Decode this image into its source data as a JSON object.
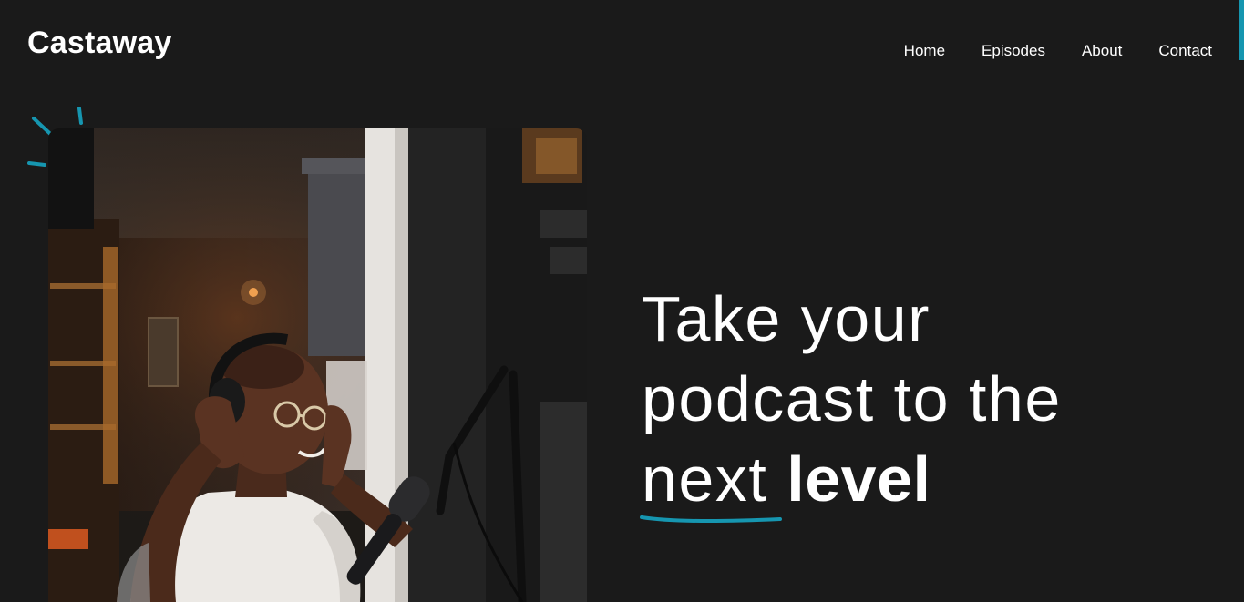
{
  "site": {
    "brand": "Castaway"
  },
  "nav": {
    "items": [
      {
        "label": "Home"
      },
      {
        "label": "Episodes"
      },
      {
        "label": "About"
      },
      {
        "label": "Contact"
      }
    ]
  },
  "hero": {
    "headline_line1": "Take your",
    "headline_line2": "podcast to the",
    "headline_word_next": "next",
    "headline_word_level": "level",
    "image_subject": "podcaster-with-headphones-and-microphone"
  },
  "colors": {
    "background": "#1a1a1a",
    "text": "#ffffff",
    "accent": "#1696b0"
  }
}
